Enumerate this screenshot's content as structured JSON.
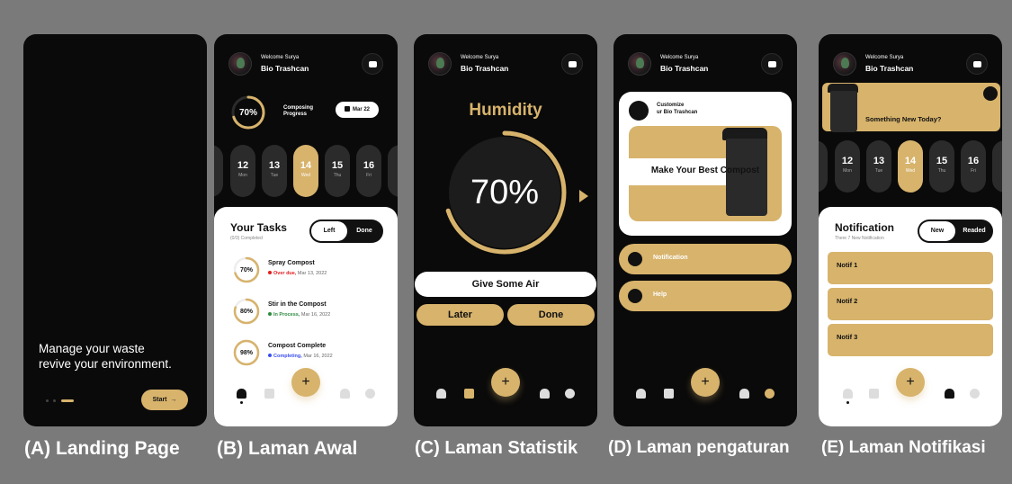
{
  "colors": {
    "gold": "#d7b36c",
    "dark": "#0a0a0a",
    "background": "#7a7a7a",
    "overdue": "#e02020",
    "in_process": "#2d8a3e",
    "completing": "#3a4ef0"
  },
  "captions": {
    "a": "(A) Landing Page",
    "b": "(B) Laman Awal",
    "c": "(C) Laman Statistik",
    "d": "(D) Laman pengaturan",
    "e": "(E) Laman Notifikasi"
  },
  "landing": {
    "line1": "Manage your waste",
    "line2": "revive your environment.",
    "start_label": "Start",
    "start_icon": "arrow-right-icon"
  },
  "header": {
    "welcome": "Welcome Surya",
    "app_name": "Bio Trashcan",
    "action_icon": "message-icon"
  },
  "home": {
    "progress_percent": 70,
    "progress_label": "70%",
    "progress_title_1": "Composing",
    "progress_title_2": "Progress",
    "date_chip": "Mar 22",
    "dates": [
      {
        "day": "12",
        "weekday": "Mon",
        "active": false
      },
      {
        "day": "13",
        "weekday": "Tue",
        "active": false
      },
      {
        "day": "14",
        "weekday": "Wed",
        "active": true
      },
      {
        "day": "15",
        "weekday": "Thu",
        "active": false
      },
      {
        "day": "16",
        "weekday": "Fri",
        "active": false
      }
    ],
    "tasks_title": "Your Tasks",
    "tasks_subtitle": "(0/3) Completed",
    "toggle_left": "Left",
    "toggle_right": "Done",
    "tasks": [
      {
        "percent": 70,
        "label": "70%",
        "name": "Spray Compost",
        "status": "Over due,",
        "date": "Mar 13, 2022",
        "status_color": "#e02020"
      },
      {
        "percent": 80,
        "label": "80%",
        "name": "Stir in the Compost",
        "status": "In Process,",
        "date": "Mar 16, 2022",
        "status_color": "#2d8a3e"
      },
      {
        "percent": 98,
        "label": "98%",
        "name": "Compost Complete",
        "status": "Completing,",
        "date": "Mar 16, 2022",
        "status_color": "#3a4ef0"
      }
    ]
  },
  "stats": {
    "title": "Humidity",
    "percent": 70,
    "label": "70%",
    "primary_button": "Give Some Air",
    "later_button": "Later",
    "done_button": "Done"
  },
  "settings": {
    "customize_1": "Customize",
    "customize_2": "ur Bio Trashcan",
    "banner": "Make Your Best Compost",
    "menu": [
      {
        "label": "Notification",
        "icon": "bell-icon"
      },
      {
        "label": "Help",
        "icon": "help-icon"
      }
    ]
  },
  "notifications": {
    "banner": "Something New Today?",
    "title": "Notification",
    "subtitle": "There 7 New Notification",
    "toggle_left": "New",
    "toggle_right": "Readed",
    "items": [
      "Notif 1",
      "Notif 2",
      "Notif 3"
    ]
  },
  "nav": {
    "plus": "+",
    "icons": [
      "home-icon",
      "stats-icon",
      "bell-icon",
      "settings-icon"
    ]
  }
}
